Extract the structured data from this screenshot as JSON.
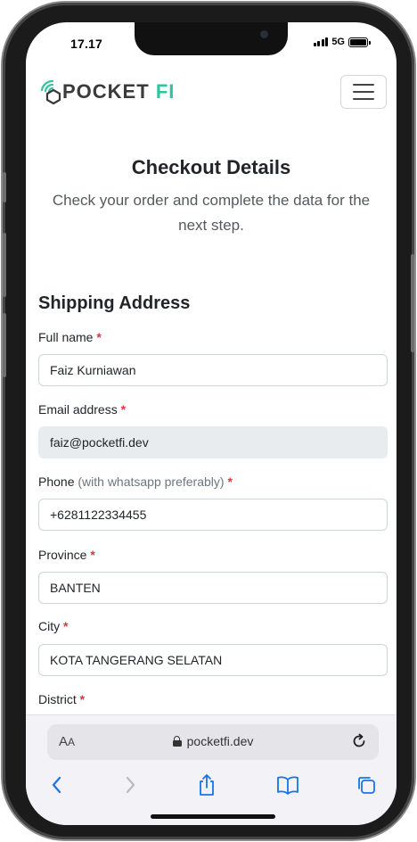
{
  "status_bar": {
    "time": "17.17",
    "network": "5G"
  },
  "navbar": {
    "logo_pocket": "POCKET",
    "logo_fi": "FI"
  },
  "header": {
    "title": "Checkout Details",
    "subtitle": "Check your order and complete the data for the next step."
  },
  "shipping": {
    "section_title": "Shipping Address",
    "required_mark": "*",
    "fields": [
      {
        "label": "Full name",
        "value": "Faiz Kurniawan"
      },
      {
        "label": "Email address",
        "value": "faiz@pocketfi.dev"
      },
      {
        "label": "Phone",
        "hint": "(with whatsapp preferably)",
        "value": "+6281122334455"
      },
      {
        "label": "Province",
        "value": "BANTEN"
      },
      {
        "label": "City",
        "value": "KOTA TANGERANG SELATAN"
      },
      {
        "label": "District"
      }
    ]
  },
  "browser": {
    "aa_large": "A",
    "aa_small": "A",
    "url": "pocketfi.dev"
  },
  "colors": {
    "accent": "#2ec4a0",
    "required": "#dc3545",
    "ios_blue": "#1a73e8"
  }
}
